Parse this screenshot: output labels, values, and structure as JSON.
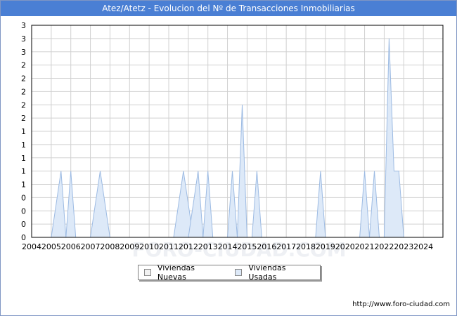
{
  "title": "Atez/Atetz - Evolucion del Nº de Transacciones Inmobiliarias",
  "footer": "http://www.foro-ciudad.com",
  "watermark": "FORO-CIUDAD.COM",
  "colors": {
    "title_bg": "#4a7fd4",
    "nuevas": "#f2f2f2",
    "usadas_fill": "#dde9f8",
    "usadas_line": "#9dbbe3",
    "grid": "#d0d0d0"
  },
  "chart_data": {
    "type": "area",
    "title": "Atez/Atetz - Evolucion del Nº de Transacciones Inmobiliarias",
    "xlabel": "",
    "ylabel": "",
    "xlim": [
      2004,
      2025
    ],
    "ylim": [
      0,
      3.2
    ],
    "x_ticks": [
      "2004",
      "2005",
      "2006",
      "2007",
      "2008",
      "2009",
      "2010",
      "2011",
      "2012",
      "2013",
      "2014",
      "2015",
      "2016",
      "2017",
      "2018",
      "2019",
      "2020",
      "2021",
      "2022",
      "2023",
      "2024"
    ],
    "y_tick_values": [
      0,
      0.2,
      0.4,
      0.6,
      0.8,
      1.0,
      1.2,
      1.4,
      1.6,
      1.8,
      2.0,
      2.2,
      2.4,
      2.6,
      2.8,
      3.0,
      3.2
    ],
    "y_tick_labels": [
      "0",
      "0",
      "0",
      "0",
      "1",
      "1",
      "1",
      "1",
      "1",
      "2",
      "2",
      "2",
      "2",
      "2",
      "3",
      "3",
      "3"
    ],
    "grid": true,
    "legend_position": "bottom",
    "series": [
      {
        "name": "Viviendas Nuevas",
        "points": []
      },
      {
        "name": "Viviendas Usadas",
        "points": [
          [
            2005.0,
            0
          ],
          [
            2005.5,
            1
          ],
          [
            2005.75,
            0
          ],
          [
            2005.75,
            0
          ],
          [
            2006.0,
            1
          ],
          [
            2006.25,
            0
          ],
          [
            2007.0,
            0
          ],
          [
            2007.5,
            1
          ],
          [
            2008.0,
            0
          ],
          [
            2011.25,
            0
          ],
          [
            2011.75,
            1
          ],
          [
            2012.25,
            0
          ],
          [
            2012.0,
            0
          ],
          [
            2012.5,
            1
          ],
          [
            2012.75,
            0
          ],
          [
            2012.75,
            0
          ],
          [
            2013.0,
            1
          ],
          [
            2013.25,
            0
          ],
          [
            2014.0,
            0
          ],
          [
            2014.25,
            1
          ],
          [
            2014.5,
            0
          ],
          [
            2014.5,
            0
          ],
          [
            2014.75,
            2
          ],
          [
            2015.0,
            0
          ],
          [
            2015.25,
            0
          ],
          [
            2015.5,
            1
          ],
          [
            2015.75,
            0
          ],
          [
            2018.5,
            0
          ],
          [
            2018.75,
            1
          ],
          [
            2019.0,
            0
          ],
          [
            2020.75,
            0
          ],
          [
            2021.0,
            1
          ],
          [
            2021.25,
            0
          ],
          [
            2021.25,
            0
          ],
          [
            2021.5,
            1
          ],
          [
            2021.75,
            0
          ],
          [
            2022.0,
            0
          ],
          [
            2022.25,
            3
          ],
          [
            2022.5,
            1
          ],
          [
            2022.75,
            1
          ],
          [
            2023.0,
            0
          ]
        ]
      }
    ]
  }
}
